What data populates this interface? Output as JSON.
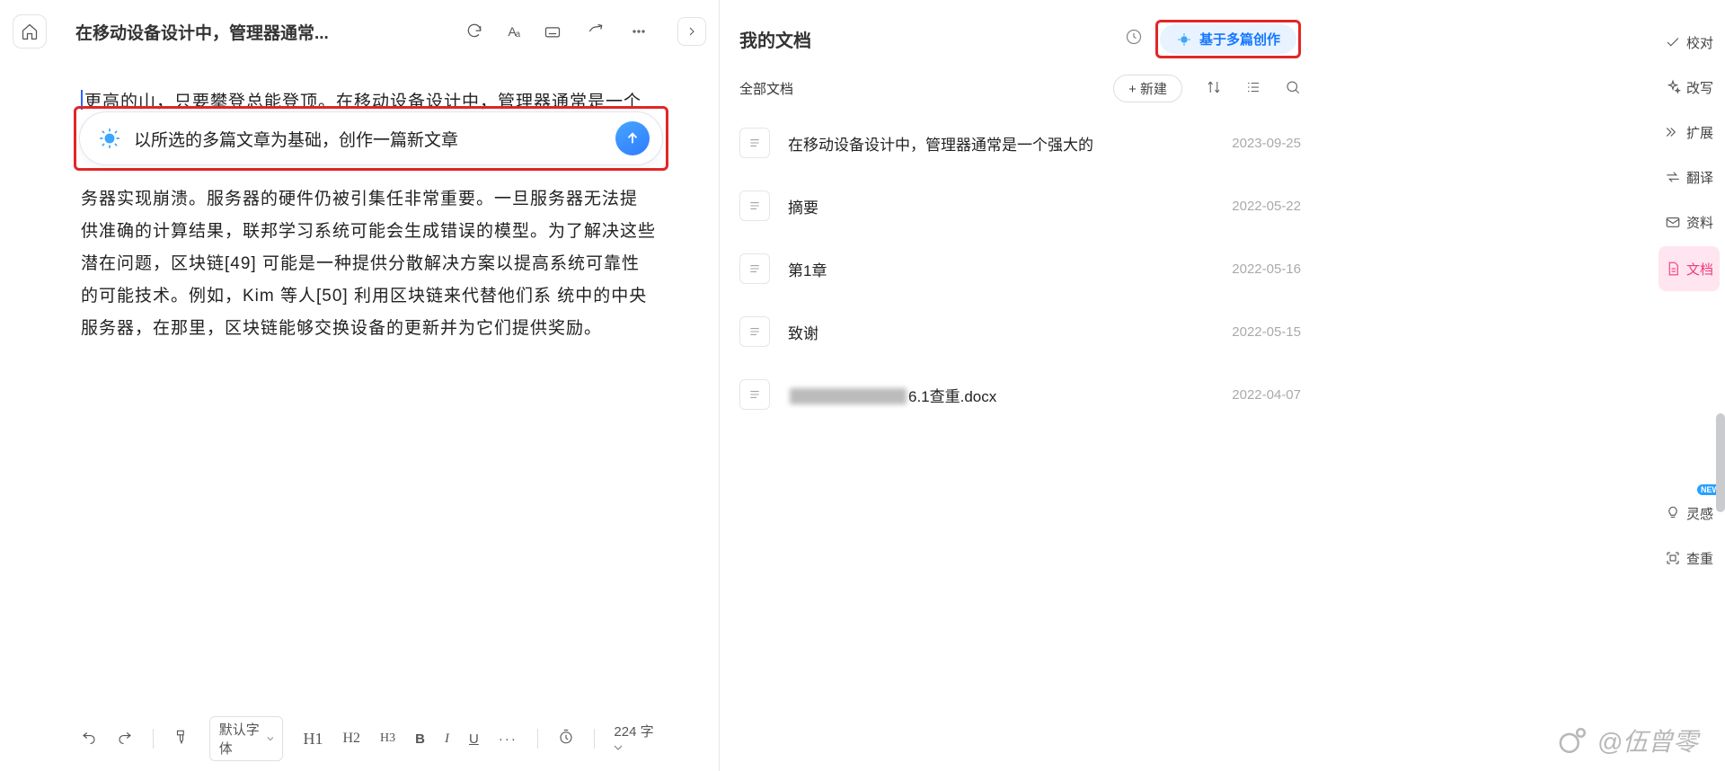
{
  "left": {
    "title": "在移动设备设计中，管理器通常...",
    "aa": "Aₐ",
    "body_line1_pre": "更高的山，只要攀登总能登顶。在移动设备设计中，管理器通常是一个强",
    "body_line3": "务器实现崩溃。服务器的硬件仍被引集任非常重要。一旦服务器无法提",
    "body_rest": "供准确的计算结果，联邦学习系统可能会生成错误的模型。为了解决这些潜在问题，区块链[49] 可能是一种提供分散解决方案以提高系统可靠性的可能技术。例如，Kim 等人[50] 利用区块链来代替他们系 统中的中央服务器，在那里，区块链能够交换设备的更新并为它们提供奖励。"
  },
  "pill": {
    "text": "以所选的多篇文章为基础，创作一篇新文章"
  },
  "bottom": {
    "font": "默认字体",
    "h1": "H1",
    "h2": "H2",
    "h3": "H3",
    "b": "B",
    "i": "I",
    "u": "U",
    "more": "···",
    "words": "224 字"
  },
  "mid": {
    "title": "我的文档",
    "multi": "基于多篇创作",
    "all": "全部文档",
    "new": "+ 新建"
  },
  "docs": [
    {
      "name": "在移动设备设计中，管理器通常是一个强大的",
      "date": "2023-09-25"
    },
    {
      "name": "摘要",
      "date": "2022-05-22"
    },
    {
      "name": "第1章",
      "date": "2022-05-16"
    },
    {
      "name": "致谢",
      "date": "2022-05-15"
    },
    {
      "name_prefix": "",
      "name_suffix": "6.1查重.docx",
      "date": "2022-04-07",
      "redacted": true
    }
  ],
  "rail": [
    {
      "label": "校对",
      "icon": "check"
    },
    {
      "label": "改写",
      "icon": "sparkle"
    },
    {
      "label": "扩展",
      "icon": "expand"
    },
    {
      "label": "翻译",
      "icon": "swap"
    },
    {
      "label": "资料",
      "icon": "mail"
    },
    {
      "label": "文档",
      "icon": "doc",
      "active": true
    },
    {
      "label": "灵感",
      "icon": "bulb",
      "new": true
    },
    {
      "label": "查重",
      "icon": "scan"
    }
  ],
  "watermark": "@伍曾零"
}
